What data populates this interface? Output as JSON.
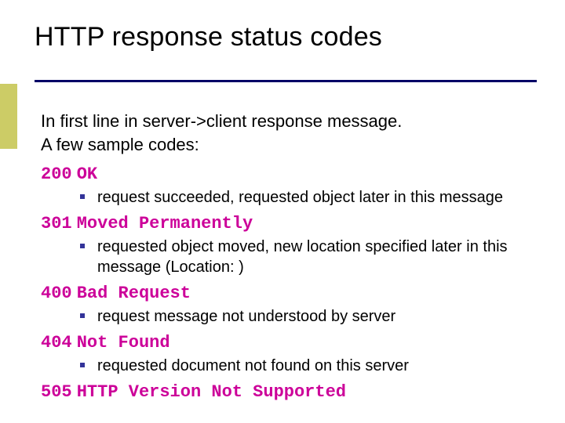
{
  "title": "HTTP response status codes",
  "intro_line1": "In first line in server->client response message.",
  "intro_line2": "A few sample codes:",
  "codes": [
    {
      "num": "200",
      "phrase": "OK",
      "desc": "request succeeded, requested object later in this message"
    },
    {
      "num": "301",
      "phrase": "Moved Permanently",
      "desc": "requested object moved, new location specified later in this message (Location: )"
    },
    {
      "num": "400",
      "phrase": "Bad Request",
      "desc": "request message not understood by server"
    },
    {
      "num": "404",
      "phrase": "Not Found",
      "desc": "requested document not found on this server"
    },
    {
      "num": "505",
      "phrase": "HTTP Version Not Supported",
      "desc": ""
    }
  ]
}
